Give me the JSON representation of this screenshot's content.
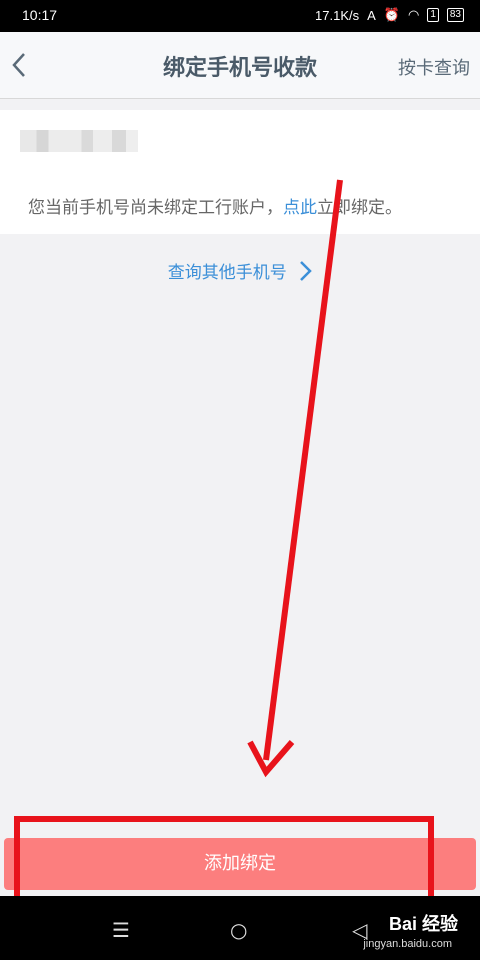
{
  "status_bar": {
    "time": "10:17",
    "speed": "17.1K/s",
    "battery": "83"
  },
  "header": {
    "title": "绑定手机号收款",
    "right_link": "按卡查询"
  },
  "card": {
    "notice_prefix": "您当前手机号尚未绑定工行账户，",
    "notice_link": "点此",
    "notice_suffix": "立即绑定。"
  },
  "query_other": "查询其他手机号",
  "bind_button": "添加绑定",
  "watermark": {
    "brand": "Bai 经验",
    "url": "jingyan.baidu.com"
  },
  "colors": {
    "accent_blue": "#3b8fd8",
    "button_red": "#fc7e7e",
    "annotation_red": "#e8131b"
  }
}
